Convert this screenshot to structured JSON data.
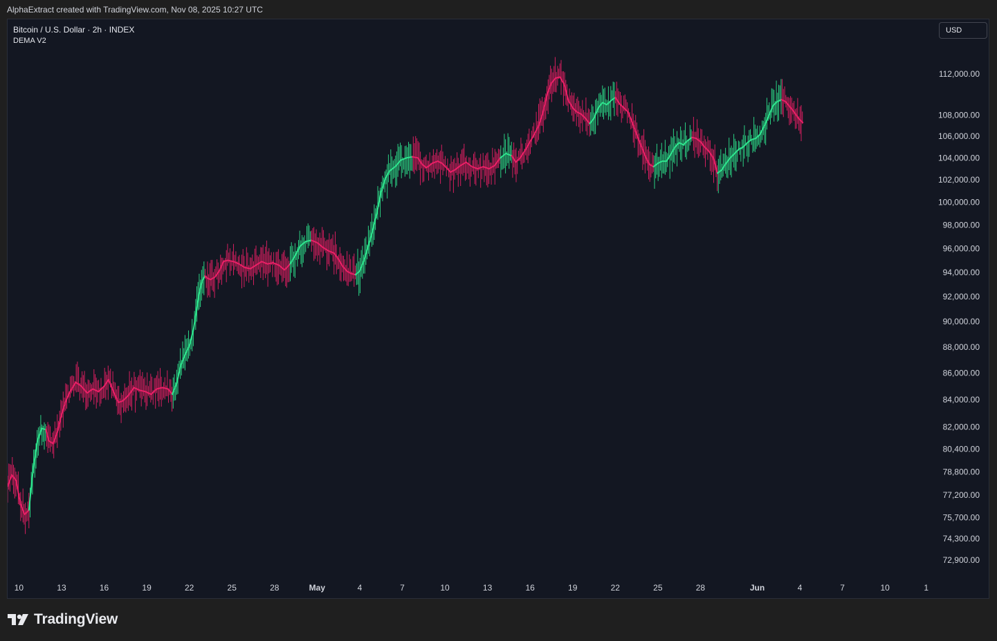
{
  "header": {
    "credit": "AlphaExtract created with TradingView.com, Nov 08, 2025 10:27 UTC"
  },
  "legend": {
    "symbol": "Bitcoin / U.S. Dollar · 2h · INDEX",
    "indicator": "DEMA V2"
  },
  "currency_button": {
    "label": "USD"
  },
  "brand": {
    "name": "TradingView",
    "icon": "tradingview-logo-icon"
  },
  "colors": {
    "background": "#131722",
    "frame": "#1f1f1f",
    "up": "#2ee68e",
    "down": "#ea1f66",
    "text": "#d1d4dc"
  },
  "chart_data": {
    "type": "line",
    "title": "Bitcoin / U.S. Dollar · 2h · INDEX",
    "subtitle": "DEMA V2",
    "xlabel": "",
    "ylabel": "",
    "y_scale": "log",
    "ylim": [
      71500,
      114500
    ],
    "grid": false,
    "x_ticks": [
      {
        "label": "10",
        "day": 9.5
      },
      {
        "label": "13",
        "day": 12.5
      },
      {
        "label": "16",
        "day": 15.5
      },
      {
        "label": "19",
        "day": 18.5
      },
      {
        "label": "22",
        "day": 21.5
      },
      {
        "label": "25",
        "day": 24.5
      },
      {
        "label": "28",
        "day": 27.5
      },
      {
        "label": "May",
        "day": 30.5,
        "bold": true
      },
      {
        "label": "4",
        "day": 33.5
      },
      {
        "label": "7",
        "day": 36.5
      },
      {
        "label": "10",
        "day": 39.5
      },
      {
        "label": "13",
        "day": 42.5
      },
      {
        "label": "16",
        "day": 45.5
      },
      {
        "label": "19",
        "day": 48.5
      },
      {
        "label": "22",
        "day": 51.5
      },
      {
        "label": "25",
        "day": 54.5
      },
      {
        "label": "28",
        "day": 57.5
      },
      {
        "label": "Jun",
        "day": 61.5,
        "bold": true
      },
      {
        "label": "4",
        "day": 64.5
      },
      {
        "label": "7",
        "day": 67.5
      },
      {
        "label": "10",
        "day": 70.5
      },
      {
        "label": "1",
        "day": 73.4
      }
    ],
    "y_ticks": [
      {
        "label": "112,000.00",
        "value": 112000
      },
      {
        "label": "108,000.00",
        "value": 108000
      },
      {
        "label": "106,000.00",
        "value": 106000
      },
      {
        "label": "104,000.00",
        "value": 104000
      },
      {
        "label": "102,000.00",
        "value": 102000
      },
      {
        "label": "100,000.00",
        "value": 100000
      },
      {
        "label": "98,000.00",
        "value": 98000
      },
      {
        "label": "96,000.00",
        "value": 96000
      },
      {
        "label": "94,000.00",
        "value": 94000
      },
      {
        "label": "92,000.00",
        "value": 92000
      },
      {
        "label": "90,000.00",
        "value": 90000
      },
      {
        "label": "88,000.00",
        "value": 88000
      },
      {
        "label": "86,000.00",
        "value": 86000
      },
      {
        "label": "84,000.00",
        "value": 84000
      },
      {
        "label": "82,000.00",
        "value": 82000
      },
      {
        "label": "80,400.00",
        "value": 80400
      },
      {
        "label": "78,800.00",
        "value": 78800
      },
      {
        "label": "77,200.00",
        "value": 77200
      },
      {
        "label": "75,700.00",
        "value": 75700
      },
      {
        "label": "74,300.00",
        "value": 74300
      },
      {
        "label": "72,900.00",
        "value": 72900
      }
    ],
    "x_range": [
      8.7,
      74.0
    ],
    "series": [
      {
        "indicator": "DEMA",
        "color_up": "#2ee68e",
        "color_down": "#ea1f66",
        "points": [
          {
            "day": 8.7,
            "v": 77800
          },
          {
            "day": 9.0,
            "v": 78600
          },
          {
            "day": 9.3,
            "v": 78200
          },
          {
            "day": 9.6,
            "v": 76600
          },
          {
            "day": 9.9,
            "v": 75900
          },
          {
            "day": 10.2,
            "v": 76200
          },
          {
            "day": 10.5,
            "v": 79000
          },
          {
            "day": 10.8,
            "v": 81000
          },
          {
            "day": 11.1,
            "v": 81900
          },
          {
            "day": 11.4,
            "v": 81800
          },
          {
            "day": 11.6,
            "v": 81000
          },
          {
            "day": 11.9,
            "v": 80800
          },
          {
            "day": 12.2,
            "v": 81600
          },
          {
            "day": 12.5,
            "v": 82900
          },
          {
            "day": 12.8,
            "v": 83900
          },
          {
            "day": 13.1,
            "v": 84600
          },
          {
            "day": 13.5,
            "v": 85300
          },
          {
            "day": 13.9,
            "v": 85000
          },
          {
            "day": 14.3,
            "v": 84500
          },
          {
            "day": 14.7,
            "v": 84800
          },
          {
            "day": 15.1,
            "v": 84600
          },
          {
            "day": 15.5,
            "v": 85000
          },
          {
            "day": 15.8,
            "v": 85500
          },
          {
            "day": 16.2,
            "v": 84500
          },
          {
            "day": 16.5,
            "v": 83800
          },
          {
            "day": 16.8,
            "v": 83900
          },
          {
            "day": 17.2,
            "v": 84300
          },
          {
            "day": 17.6,
            "v": 84900
          },
          {
            "day": 18.0,
            "v": 84700
          },
          {
            "day": 18.4,
            "v": 84600
          },
          {
            "day": 18.8,
            "v": 84400
          },
          {
            "day": 19.2,
            "v": 84800
          },
          {
            "day": 19.6,
            "v": 84900
          },
          {
            "day": 20.0,
            "v": 84800
          },
          {
            "day": 20.3,
            "v": 84400
          },
          {
            "day": 20.6,
            "v": 85200
          },
          {
            "day": 20.9,
            "v": 86600
          },
          {
            "day": 21.2,
            "v": 87400
          },
          {
            "day": 21.5,
            "v": 88100
          },
          {
            "day": 21.8,
            "v": 89400
          },
          {
            "day": 22.0,
            "v": 90900
          },
          {
            "day": 22.2,
            "v": 92300
          },
          {
            "day": 22.4,
            "v": 93300
          },
          {
            "day": 22.6,
            "v": 93700
          },
          {
            "day": 22.8,
            "v": 93500
          },
          {
            "day": 23.0,
            "v": 93400
          },
          {
            "day": 23.3,
            "v": 93600
          },
          {
            "day": 23.6,
            "v": 94100
          },
          {
            "day": 23.9,
            "v": 94900
          },
          {
            "day": 24.2,
            "v": 95000
          },
          {
            "day": 24.6,
            "v": 94900
          },
          {
            "day": 25.0,
            "v": 94700
          },
          {
            "day": 25.4,
            "v": 94400
          },
          {
            "day": 25.8,
            "v": 94300
          },
          {
            "day": 26.2,
            "v": 94600
          },
          {
            "day": 26.6,
            "v": 94900
          },
          {
            "day": 27.0,
            "v": 94700
          },
          {
            "day": 27.4,
            "v": 94800
          },
          {
            "day": 27.8,
            "v": 94600
          },
          {
            "day": 28.2,
            "v": 94200
          },
          {
            "day": 28.6,
            "v": 94700
          },
          {
            "day": 29.0,
            "v": 95500
          },
          {
            "day": 29.3,
            "v": 96200
          },
          {
            "day": 29.7,
            "v": 96600
          },
          {
            "day": 30.1,
            "v": 96700
          },
          {
            "day": 30.5,
            "v": 96500
          },
          {
            "day": 30.9,
            "v": 96100
          },
          {
            "day": 31.3,
            "v": 95800
          },
          {
            "day": 31.7,
            "v": 95600
          },
          {
            "day": 32.0,
            "v": 95100
          },
          {
            "day": 32.3,
            "v": 94500
          },
          {
            "day": 32.6,
            "v": 94100
          },
          {
            "day": 32.9,
            "v": 93900
          },
          {
            "day": 33.2,
            "v": 93800
          },
          {
            "day": 33.5,
            "v": 94100
          },
          {
            "day": 33.8,
            "v": 95000
          },
          {
            "day": 34.1,
            "v": 96200
          },
          {
            "day": 34.4,
            "v": 97500
          },
          {
            "day": 34.7,
            "v": 99000
          },
          {
            "day": 35.0,
            "v": 100900
          },
          {
            "day": 35.3,
            "v": 102100
          },
          {
            "day": 35.6,
            "v": 102800
          },
          {
            "day": 36.0,
            "v": 103200
          },
          {
            "day": 36.4,
            "v": 103800
          },
          {
            "day": 36.8,
            "v": 104000
          },
          {
            "day": 37.2,
            "v": 104100
          },
          {
            "day": 37.6,
            "v": 104000
          },
          {
            "day": 37.9,
            "v": 103400
          },
          {
            "day": 38.2,
            "v": 103100
          },
          {
            "day": 38.6,
            "v": 103500
          },
          {
            "day": 39.0,
            "v": 103700
          },
          {
            "day": 39.3,
            "v": 103500
          },
          {
            "day": 39.6,
            "v": 103100
          },
          {
            "day": 39.9,
            "v": 102700
          },
          {
            "day": 40.2,
            "v": 102900
          },
          {
            "day": 40.6,
            "v": 103300
          },
          {
            "day": 41.0,
            "v": 103600
          },
          {
            "day": 41.4,
            "v": 103200
          },
          {
            "day": 41.8,
            "v": 103000
          },
          {
            "day": 42.2,
            "v": 103200
          },
          {
            "day": 42.6,
            "v": 103000
          },
          {
            "day": 43.0,
            "v": 103300
          },
          {
            "day": 43.4,
            "v": 104000
          },
          {
            "day": 43.8,
            "v": 104400
          },
          {
            "day": 44.2,
            "v": 104200
          },
          {
            "day": 44.5,
            "v": 103600
          },
          {
            "day": 44.8,
            "v": 104000
          },
          {
            "day": 45.2,
            "v": 104800
          },
          {
            "day": 45.5,
            "v": 105500
          },
          {
            "day": 45.8,
            "v": 106200
          },
          {
            "day": 46.1,
            "v": 107000
          },
          {
            "day": 46.4,
            "v": 108200
          },
          {
            "day": 46.7,
            "v": 110000
          },
          {
            "day": 47.0,
            "v": 111100
          },
          {
            "day": 47.3,
            "v": 111600
          },
          {
            "day": 47.6,
            "v": 111700
          },
          {
            "day": 47.9,
            "v": 111000
          },
          {
            "day": 48.2,
            "v": 109400
          },
          {
            "day": 48.5,
            "v": 108700
          },
          {
            "day": 48.8,
            "v": 108300
          },
          {
            "day": 49.1,
            "v": 108100
          },
          {
            "day": 49.4,
            "v": 107700
          },
          {
            "day": 49.7,
            "v": 107200
          },
          {
            "day": 50.0,
            "v": 107700
          },
          {
            "day": 50.3,
            "v": 108700
          },
          {
            "day": 50.6,
            "v": 109200
          },
          {
            "day": 50.9,
            "v": 109000
          },
          {
            "day": 51.2,
            "v": 109400
          },
          {
            "day": 51.5,
            "v": 109700
          },
          {
            "day": 51.8,
            "v": 109100
          },
          {
            "day": 52.1,
            "v": 108700
          },
          {
            "day": 52.4,
            "v": 108300
          },
          {
            "day": 52.7,
            "v": 107300
          },
          {
            "day": 53.0,
            "v": 106200
          },
          {
            "day": 53.3,
            "v": 105200
          },
          {
            "day": 53.6,
            "v": 104200
          },
          {
            "day": 53.9,
            "v": 103400
          },
          {
            "day": 54.2,
            "v": 103200
          },
          {
            "day": 54.5,
            "v": 103500
          },
          {
            "day": 54.8,
            "v": 103700
          },
          {
            "day": 55.1,
            "v": 103700
          },
          {
            "day": 55.4,
            "v": 104300
          },
          {
            "day": 55.7,
            "v": 105000
          },
          {
            "day": 56.0,
            "v": 105400
          },
          {
            "day": 56.3,
            "v": 105200
          },
          {
            "day": 56.6,
            "v": 105600
          },
          {
            "day": 56.9,
            "v": 105900
          },
          {
            "day": 57.2,
            "v": 105800
          },
          {
            "day": 57.5,
            "v": 105500
          },
          {
            "day": 57.8,
            "v": 105000
          },
          {
            "day": 58.1,
            "v": 104600
          },
          {
            "day": 58.4,
            "v": 104000
          },
          {
            "day": 58.7,
            "v": 102600
          },
          {
            "day": 59.0,
            "v": 102900
          },
          {
            "day": 59.3,
            "v": 103500
          },
          {
            "day": 59.6,
            "v": 104000
          },
          {
            "day": 59.9,
            "v": 104400
          },
          {
            "day": 60.2,
            "v": 104800
          },
          {
            "day": 60.5,
            "v": 105000
          },
          {
            "day": 60.8,
            "v": 105400
          },
          {
            "day": 61.1,
            "v": 105700
          },
          {
            "day": 61.4,
            "v": 105800
          },
          {
            "day": 61.7,
            "v": 106200
          },
          {
            "day": 62.0,
            "v": 107000
          },
          {
            "day": 62.3,
            "v": 107900
          },
          {
            "day": 62.6,
            "v": 108900
          },
          {
            "day": 62.9,
            "v": 109300
          },
          {
            "day": 63.2,
            "v": 109500
          },
          {
            "day": 63.5,
            "v": 109300
          },
          {
            "day": 63.8,
            "v": 108800
          },
          {
            "day": 64.1,
            "v": 108300
          },
          {
            "day": 64.4,
            "v": 107700
          },
          {
            "day": 64.7,
            "v": 107300
          }
        ],
        "segments": [
          {
            "from": 8.7,
            "to": 10.2,
            "trend": "down"
          },
          {
            "from": 10.2,
            "to": 11.4,
            "trend": "up"
          },
          {
            "from": 11.4,
            "to": 20.3,
            "trend": "down"
          },
          {
            "from": 20.3,
            "to": 22.6,
            "trend": "up"
          },
          {
            "from": 22.6,
            "to": 28.6,
            "trend": "down"
          },
          {
            "from": 28.6,
            "to": 30.1,
            "trend": "up"
          },
          {
            "from": 30.1,
            "to": 33.2,
            "trend": "down"
          },
          {
            "from": 33.2,
            "to": 37.2,
            "trend": "up"
          },
          {
            "from": 37.2,
            "to": 43.4,
            "trend": "down"
          },
          {
            "from": 43.4,
            "to": 44.2,
            "trend": "up"
          },
          {
            "from": 44.2,
            "to": 47.6,
            "trend": "down"
          },
          {
            "from": 47.6,
            "to": 49.7,
            "trend": "down"
          },
          {
            "from": 49.7,
            "to": 51.5,
            "trend": "up"
          },
          {
            "from": 51.5,
            "to": 54.2,
            "trend": "down"
          },
          {
            "from": 54.2,
            "to": 56.9,
            "trend": "up"
          },
          {
            "from": 56.9,
            "to": 58.7,
            "trend": "down"
          },
          {
            "from": 58.7,
            "to": 63.2,
            "trend": "up"
          },
          {
            "from": 63.2,
            "to": 64.7,
            "trend": "down"
          }
        ]
      }
    ]
  }
}
